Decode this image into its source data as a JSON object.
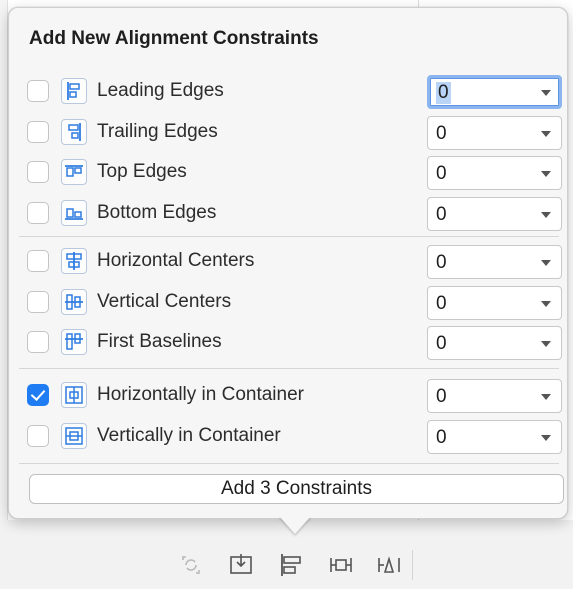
{
  "popover": {
    "title": "Add New Alignment Constraints",
    "add_button_label": "Add 3 Constraints"
  },
  "constraints": [
    {
      "label": "Leading Edges",
      "checked": false,
      "value": "0",
      "icon": "leading-edges-icon"
    },
    {
      "label": "Trailing Edges",
      "checked": false,
      "value": "0",
      "icon": "trailing-edges-icon"
    },
    {
      "label": "Top Edges",
      "checked": false,
      "value": "0",
      "icon": "top-edges-icon"
    },
    {
      "label": "Bottom Edges",
      "checked": false,
      "value": "0",
      "icon": "bottom-edges-icon"
    },
    {
      "label": "Horizontal Centers",
      "checked": false,
      "value": "0",
      "icon": "horizontal-centers-icon"
    },
    {
      "label": "Vertical Centers",
      "checked": false,
      "value": "0",
      "icon": "vertical-centers-icon"
    },
    {
      "label": "First Baselines",
      "checked": false,
      "value": "0",
      "icon": "first-baselines-icon"
    },
    {
      "label": "Horizontally in Container",
      "checked": true,
      "value": "0",
      "icon": "horizontally-in-container-icon"
    },
    {
      "label": "Vertically in Container",
      "checked": false,
      "value": "0",
      "icon": "vertically-in-container-icon"
    }
  ],
  "toolbar": {
    "icons": [
      "update-frames-icon",
      "embed-in-icon",
      "align-icon",
      "add-new-constraints-icon",
      "resolve-auto-layout-issues-icon"
    ]
  },
  "colors": {
    "accent": "#1f7cf3",
    "focus_ring": "#8cb4ef",
    "icon_blue": "#2f7de1",
    "popover_bg": "#f6f6f6"
  }
}
